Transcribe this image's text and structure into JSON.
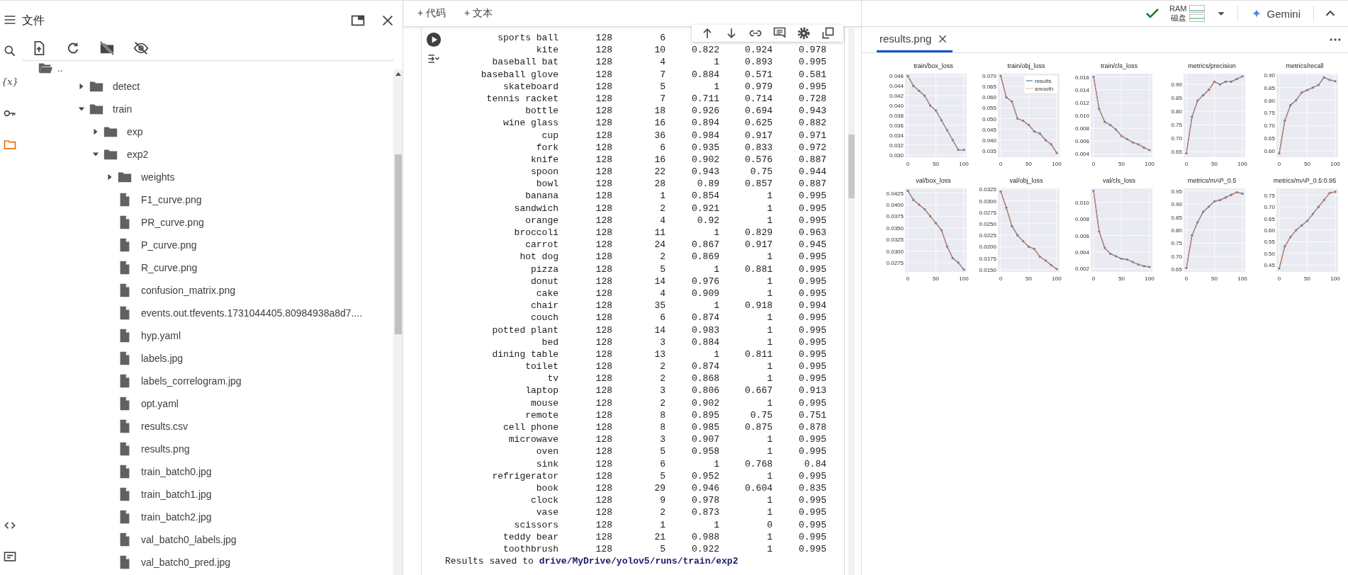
{
  "rail": [
    {
      "kind": "menu",
      "selected": false
    },
    {
      "kind": "search",
      "selected": false
    },
    {
      "kind": "variables",
      "label": "{x}",
      "selected": false
    },
    {
      "kind": "secrets",
      "selected": false
    },
    {
      "kind": "files",
      "selected": true
    },
    {
      "kind": "code",
      "selected": false
    },
    {
      "kind": "terminal",
      "selected": false
    }
  ],
  "files_panel": {
    "title": "文件",
    "tree": [
      {
        "name": "..",
        "kind": "parent"
      },
      {
        "name": "detect",
        "kind": "folder",
        "expanded": false
      },
      {
        "name": "train",
        "kind": "folder",
        "expanded": true,
        "children": [
          {
            "name": "exp",
            "kind": "folder",
            "expanded": false
          },
          {
            "name": "exp2",
            "kind": "folder",
            "expanded": true,
            "children": [
              {
                "name": "weights",
                "kind": "folder",
                "expanded": false
              },
              {
                "name": "F1_curve.png",
                "kind": "file"
              },
              {
                "name": "PR_curve.png",
                "kind": "file"
              },
              {
                "name": "P_curve.png",
                "kind": "file"
              },
              {
                "name": "R_curve.png",
                "kind": "file"
              },
              {
                "name": "confusion_matrix.png",
                "kind": "file"
              },
              {
                "name": "events.out.tfevents.1731044405.80984938a8d7....",
                "kind": "file"
              },
              {
                "name": "hyp.yaml",
                "kind": "file"
              },
              {
                "name": "labels.jpg",
                "kind": "file"
              },
              {
                "name": "labels_correlogram.jpg",
                "kind": "file"
              },
              {
                "name": "opt.yaml",
                "kind": "file"
              },
              {
                "name": "results.csv",
                "kind": "file"
              },
              {
                "name": "results.png",
                "kind": "file"
              },
              {
                "name": "train_batch0.jpg",
                "kind": "file"
              },
              {
                "name": "train_batch1.jpg",
                "kind": "file"
              },
              {
                "name": "train_batch2.jpg",
                "kind": "file"
              },
              {
                "name": "val_batch0_labels.jpg",
                "kind": "file"
              },
              {
                "name": "val_batch0_pred.jpg",
                "kind": "file"
              }
            ]
          }
        ]
      }
    ]
  },
  "notebook": {
    "toolbar": [
      "+ 代码",
      "+ 文本"
    ],
    "output": {
      "rows": [
        [
          "sports ball",
          "128",
          "6"
        ],
        [
          "kite",
          "128",
          "10",
          "0.822",
          "0.924",
          "0.978"
        ],
        [
          "baseball bat",
          "128",
          "4",
          "1",
          "0.893",
          "0.995"
        ],
        [
          "baseball glove",
          "128",
          "7",
          "0.884",
          "0.571",
          "0.581"
        ],
        [
          "skateboard",
          "128",
          "5",
          "1",
          "0.979",
          "0.995"
        ],
        [
          "tennis racket",
          "128",
          "7",
          "0.711",
          "0.714",
          "0.728"
        ],
        [
          "bottle",
          "128",
          "18",
          "0.926",
          "0.694",
          "0.943"
        ],
        [
          "wine glass",
          "128",
          "16",
          "0.894",
          "0.625",
          "0.882"
        ],
        [
          "cup",
          "128",
          "36",
          "0.984",
          "0.917",
          "0.971"
        ],
        [
          "fork",
          "128",
          "6",
          "0.935",
          "0.833",
          "0.972"
        ],
        [
          "knife",
          "128",
          "16",
          "0.902",
          "0.576",
          "0.887"
        ],
        [
          "spoon",
          "128",
          "22",
          "0.943",
          "0.75",
          "0.944"
        ],
        [
          "bowl",
          "128",
          "28",
          "0.89",
          "0.857",
          "0.887"
        ],
        [
          "banana",
          "128",
          "1",
          "0.854",
          "1",
          "0.995"
        ],
        [
          "sandwich",
          "128",
          "2",
          "0.921",
          "1",
          "0.995"
        ],
        [
          "orange",
          "128",
          "4",
          "0.92",
          "1",
          "0.995"
        ],
        [
          "broccoli",
          "128",
          "11",
          "1",
          "0.829",
          "0.963"
        ],
        [
          "carrot",
          "128",
          "24",
          "0.867",
          "0.917",
          "0.945"
        ],
        [
          "hot dog",
          "128",
          "2",
          "0.869",
          "1",
          "0.995"
        ],
        [
          "pizza",
          "128",
          "5",
          "1",
          "0.881",
          "0.995"
        ],
        [
          "donut",
          "128",
          "14",
          "0.976",
          "1",
          "0.995"
        ],
        [
          "cake",
          "128",
          "4",
          "0.909",
          "1",
          "0.995"
        ],
        [
          "chair",
          "128",
          "35",
          "1",
          "0.918",
          "0.994"
        ],
        [
          "couch",
          "128",
          "6",
          "0.874",
          "1",
          "0.995"
        ],
        [
          "potted plant",
          "128",
          "14",
          "0.983",
          "1",
          "0.995"
        ],
        [
          "bed",
          "128",
          "3",
          "0.884",
          "1",
          "0.995"
        ],
        [
          "dining table",
          "128",
          "13",
          "1",
          "0.811",
          "0.995"
        ],
        [
          "toilet",
          "128",
          "2",
          "0.874",
          "1",
          "0.995"
        ],
        [
          "tv",
          "128",
          "2",
          "0.868",
          "1",
          "0.995"
        ],
        [
          "laptop",
          "128",
          "3",
          "0.806",
          "0.667",
          "0.913"
        ],
        [
          "mouse",
          "128",
          "2",
          "0.902",
          "1",
          "0.995"
        ],
        [
          "remote",
          "128",
          "8",
          "0.895",
          "0.75",
          "0.751"
        ],
        [
          "cell phone",
          "128",
          "8",
          "0.985",
          "0.875",
          "0.878"
        ],
        [
          "microwave",
          "128",
          "3",
          "0.907",
          "1",
          "0.995"
        ],
        [
          "oven",
          "128",
          "5",
          "0.958",
          "1",
          "0.995"
        ],
        [
          "sink",
          "128",
          "6",
          "1",
          "0.768",
          "0.84"
        ],
        [
          "refrigerator",
          "128",
          "5",
          "0.952",
          "1",
          "0.995"
        ],
        [
          "book",
          "128",
          "29",
          "0.946",
          "0.604",
          "0.835"
        ],
        [
          "clock",
          "128",
          "9",
          "0.978",
          "1",
          "0.995"
        ],
        [
          "vase",
          "128",
          "2",
          "0.873",
          "1",
          "0.995"
        ],
        [
          "scissors",
          "128",
          "1",
          "1",
          "0",
          "0.995"
        ],
        [
          "teddy bear",
          "128",
          "21",
          "0.988",
          "1",
          "0.995"
        ],
        [
          "toothbrush",
          "128",
          "5",
          "0.922",
          "1",
          "0.995"
        ]
      ],
      "footer": "Results saved to **drive/MyDrive/yolov5/runs/train/exp2**"
    }
  },
  "viewer": {
    "ram_label": "RAM",
    "disk_label": "磁盘",
    "gemini": "Gemini",
    "tabs": [
      {
        "label": "results.png",
        "selected": true
      }
    ],
    "plots": [
      {
        "chart_data": {
          "type": "line",
          "grid": true,
          "title": "train/box_loss",
          "x": [
            0,
            10,
            20,
            30,
            40,
            50,
            60,
            70,
            80,
            90,
            100
          ],
          "xlim": [
            -5,
            105
          ],
          "ylim": [
            0.0295,
            0.0465
          ],
          "xticks": [
            0,
            50,
            100
          ],
          "yticks": [
            {
              "value": 0.03,
              "label": "0.030"
            },
            0.032,
            0.034,
            0.036,
            0.038,
            {
              "value": 0.04,
              "label": "0.040"
            },
            0.042,
            0.044,
            0.046
          ],
          "series": [
            {
              "color": "#4c72b0",
              "values": [
                0.046,
                0.044,
                0.043,
                0.042,
                0.04,
                0.039,
                0.037,
                0.035,
                0.033,
                0.031,
                0.031
              ]
            },
            {
              "color": "#dd8452",
              "line_style": "dotted",
              "values": [
                0.046,
                0.044,
                0.043,
                0.042,
                0.04,
                0.039,
                0.037,
                0.035,
                0.033,
                0.031,
                0.031
              ]
            }
          ]
        }
      },
      {
        "chart_data": {
          "type": "line",
          "grid": true,
          "legend": "upper right",
          "title": "train/obj_loss",
          "x": [
            0,
            10,
            20,
            30,
            40,
            50,
            60,
            70,
            80,
            90,
            100
          ],
          "xlim": [
            -5,
            105
          ],
          "ylim": [
            0.032,
            0.071
          ],
          "xticks": [
            0,
            50,
            100
          ],
          "yticks": [
            0.035,
            {
              "value": 0.04,
              "label": "0.040"
            },
            0.045,
            {
              "value": 0.05,
              "label": "0.050"
            },
            0.055,
            {
              "value": 0.06,
              "label": "0.060"
            },
            0.065,
            {
              "value": 0.07,
              "label": "0.070"
            }
          ],
          "series": [
            {
              "name": "results",
              "color": "#4c72b0",
              "values": [
                0.07,
                0.06,
                0.058,
                0.05,
                0.049,
                0.047,
                0.044,
                0.043,
                0.04,
                0.038,
                0.034
              ]
            },
            {
              "name": "smooth",
              "color": "#dd8452",
              "line_style": "dotted",
              "values": [
                0.07,
                0.06,
                0.058,
                0.05,
                0.049,
                0.047,
                0.044,
                0.043,
                0.04,
                0.038,
                0.034
              ]
            }
          ]
        }
      },
      {
        "chart_data": {
          "type": "line",
          "grid": true,
          "title": "train/cls_loss",
          "x": [
            0,
            10,
            20,
            30,
            40,
            50,
            60,
            70,
            80,
            90,
            100
          ],
          "xlim": [
            -5,
            105
          ],
          "ylim": [
            0.0035,
            0.0165
          ],
          "xticks": [
            0,
            50,
            100
          ],
          "yticks": [
            0.004,
            0.006,
            0.008,
            {
              "value": 0.01,
              "label": "0.010"
            },
            0.012,
            0.014,
            0.016
          ],
          "series": [
            {
              "color": "#4c72b0",
              "values": [
                0.016,
                0.011,
                0.009,
                0.0085,
                0.0078,
                0.0068,
                0.0063,
                0.0058,
                0.0055,
                0.005,
                0.0046
              ]
            },
            {
              "color": "#dd8452",
              "line_style": "dotted",
              "values": [
                0.016,
                0.011,
                0.009,
                0.0085,
                0.0078,
                0.0068,
                0.0063,
                0.0058,
                0.0055,
                0.005,
                0.0046
              ]
            }
          ]
        }
      },
      {
        "chart_data": {
          "type": "line",
          "grid": true,
          "title": "metrics/precision",
          "x": [
            0,
            10,
            20,
            30,
            40,
            50,
            60,
            70,
            80,
            90,
            100
          ],
          "xlim": [
            -5,
            105
          ],
          "ylim": [
            0.63,
            0.94
          ],
          "xticks": [
            0,
            50,
            100
          ],
          "yticks": [
            0.65,
            {
              "value": 0.7,
              "label": "0.70"
            },
            0.75,
            {
              "value": 0.8,
              "label": "0.80"
            },
            0.85,
            {
              "value": 0.9,
              "label": "0.90"
            }
          ],
          "series": [
            {
              "color": "#4c72b0",
              "values": [
                0.645,
                0.78,
                0.84,
                0.86,
                0.88,
                0.91,
                0.9,
                0.91,
                0.91,
                0.92,
                0.93
              ]
            },
            {
              "color": "#dd8452",
              "line_style": "dotted",
              "values": [
                0.645,
                0.78,
                0.84,
                0.86,
                0.88,
                0.91,
                0.9,
                0.91,
                0.91,
                0.92,
                0.93
              ]
            }
          ]
        }
      },
      {
        "chart_data": {
          "type": "line",
          "grid": true,
          "title": "metrics/recall",
          "x": [
            0,
            10,
            20,
            30,
            40,
            50,
            60,
            70,
            80,
            90,
            100
          ],
          "xlim": [
            -5,
            105
          ],
          "ylim": [
            0.575,
            0.905
          ],
          "xticks": [
            0,
            50,
            100
          ],
          "yticks": [
            {
              "value": 0.6,
              "label": "0.60"
            },
            0.65,
            {
              "value": 0.7,
              "label": "0.70"
            },
            0.75,
            {
              "value": 0.8,
              "label": "0.80"
            },
            0.85,
            {
              "value": 0.9,
              "label": "0.90"
            }
          ],
          "series": [
            {
              "color": "#4c72b0",
              "values": [
                0.59,
                0.72,
                0.78,
                0.8,
                0.83,
                0.84,
                0.85,
                0.86,
                0.89,
                0.88,
                0.875
              ]
            },
            {
              "color": "#dd8452",
              "line_style": "dotted",
              "values": [
                0.59,
                0.72,
                0.78,
                0.8,
                0.83,
                0.84,
                0.85,
                0.86,
                0.89,
                0.88,
                0.875
              ]
            }
          ]
        }
      },
      {
        "chart_data": {
          "type": "line",
          "grid": true,
          "title": "val/box_loss",
          "x": [
            0,
            10,
            20,
            30,
            40,
            50,
            60,
            70,
            80,
            90,
            100
          ],
          "xlim": [
            -5,
            105
          ],
          "ylim": [
            0.0255,
            0.0435
          ],
          "xticks": [
            0,
            50,
            100
          ],
          "yticks": [
            0.0275,
            {
              "value": 0.03,
              "label": "0.0300"
            },
            0.0325,
            {
              "value": 0.035,
              "label": "0.0350"
            },
            0.0375,
            {
              "value": 0.04,
              "label": "0.0400"
            },
            0.0425
          ],
          "series": [
            {
              "color": "#4c72b0",
              "values": [
                0.043,
                0.041,
                0.04,
                0.039,
                0.0375,
                0.036,
                0.0345,
                0.031,
                0.0285,
                0.0275,
                0.026
              ]
            },
            {
              "color": "#dd8452",
              "line_style": "dotted",
              "values": [
                0.043,
                0.041,
                0.04,
                0.039,
                0.0375,
                0.036,
                0.0345,
                0.031,
                0.0285,
                0.0275,
                0.026
              ]
            }
          ]
        }
      },
      {
        "chart_data": {
          "type": "line",
          "grid": true,
          "title": "val/obj_loss",
          "x": [
            0,
            10,
            20,
            30,
            40,
            50,
            60,
            70,
            80,
            90,
            100
          ],
          "xlim": [
            -5,
            105
          ],
          "ylim": [
            0.0145,
            0.0327
          ],
          "xticks": [
            0,
            50,
            100
          ],
          "yticks": [
            {
              "value": 0.015,
              "label": "0.0150"
            },
            0.0175,
            {
              "value": 0.02,
              "label": "0.0200"
            },
            0.0225,
            {
              "value": 0.025,
              "label": "0.0250"
            },
            0.0275,
            {
              "value": 0.03,
              "label": "0.0300"
            },
            0.0325
          ],
          "series": [
            {
              "color": "#4c72b0",
              "values": [
                0.032,
                0.0285,
                0.0245,
                0.0225,
                0.0212,
                0.02,
                0.0195,
                0.0178,
                0.017,
                0.016,
                0.0151
              ]
            },
            {
              "color": "#dd8452",
              "line_style": "dotted",
              "values": [
                0.032,
                0.0285,
                0.0245,
                0.0225,
                0.0212,
                0.02,
                0.0195,
                0.0178,
                0.017,
                0.016,
                0.0151
              ]
            }
          ]
        }
      },
      {
        "chart_data": {
          "type": "line",
          "grid": true,
          "title": "val/cls_loss",
          "x": [
            0,
            10,
            20,
            30,
            40,
            50,
            60,
            70,
            80,
            90,
            100
          ],
          "xlim": [
            -5,
            105
          ],
          "ylim": [
            0.0016,
            0.0117
          ],
          "xticks": [
            0,
            50,
            100
          ],
          "yticks": [
            0.002,
            0.004,
            0.006,
            0.008,
            {
              "value": 0.01,
              "label": "0.010"
            }
          ],
          "series": [
            {
              "color": "#4c72b0",
              "values": [
                0.0114,
                0.0065,
                0.0045,
                0.0038,
                0.0035,
                0.0032,
                0.0031,
                0.0028,
                0.0025,
                0.0023,
                0.0022
              ]
            },
            {
              "color": "#dd8452",
              "line_style": "dotted",
              "values": [
                0.0114,
                0.0065,
                0.0045,
                0.0038,
                0.0035,
                0.0032,
                0.0031,
                0.0028,
                0.0025,
                0.0023,
                0.0022
              ]
            }
          ]
        }
      },
      {
        "chart_data": {
          "type": "line",
          "grid": true,
          "title": "metrics/mAP_0.5",
          "x": [
            0,
            10,
            20,
            30,
            40,
            50,
            60,
            70,
            80,
            90,
            100
          ],
          "xlim": [
            -5,
            105
          ],
          "ylim": [
            0.64,
            0.96
          ],
          "xticks": [
            0,
            50,
            100
          ],
          "yticks": [
            0.65,
            {
              "value": 0.7,
              "label": "0.70"
            },
            0.75,
            {
              "value": 0.8,
              "label": "0.80"
            },
            0.85,
            {
              "value": 0.9,
              "label": "0.90"
            },
            0.95
          ],
          "series": [
            {
              "color": "#4c72b0",
              "values": [
                0.655,
                0.78,
                0.83,
                0.87,
                0.89,
                0.91,
                0.915,
                0.925,
                0.935,
                0.945,
                0.94
              ]
            },
            {
              "color": "#dd8452",
              "line_style": "dotted",
              "values": [
                0.655,
                0.78,
                0.83,
                0.87,
                0.89,
                0.91,
                0.915,
                0.925,
                0.935,
                0.945,
                0.94
              ]
            }
          ]
        }
      },
      {
        "chart_data": {
          "type": "line",
          "grid": true,
          "title": "metrics/mAP_0.5:0.95",
          "x": [
            0,
            10,
            20,
            30,
            40,
            50,
            60,
            70,
            80,
            90,
            100
          ],
          "xlim": [
            -5,
            105
          ],
          "ylim": [
            0.42,
            0.78
          ],
          "xticks": [
            0,
            50,
            100
          ],
          "yticks": [
            0.45,
            {
              "value": 0.5,
              "label": "0.50"
            },
            0.55,
            {
              "value": 0.6,
              "label": "0.60"
            },
            0.65,
            {
              "value": 0.7,
              "label": "0.70"
            },
            0.75
          ],
          "series": [
            {
              "color": "#4c72b0",
              "values": [
                0.435,
                0.53,
                0.57,
                0.6,
                0.62,
                0.64,
                0.67,
                0.7,
                0.73,
                0.76,
                0.765
              ]
            },
            {
              "color": "#dd8452",
              "line_style": "dotted",
              "values": [
                0.435,
                0.53,
                0.57,
                0.6,
                0.62,
                0.64,
                0.67,
                0.7,
                0.73,
                0.76,
                0.765
              ]
            }
          ]
        }
      }
    ]
  }
}
